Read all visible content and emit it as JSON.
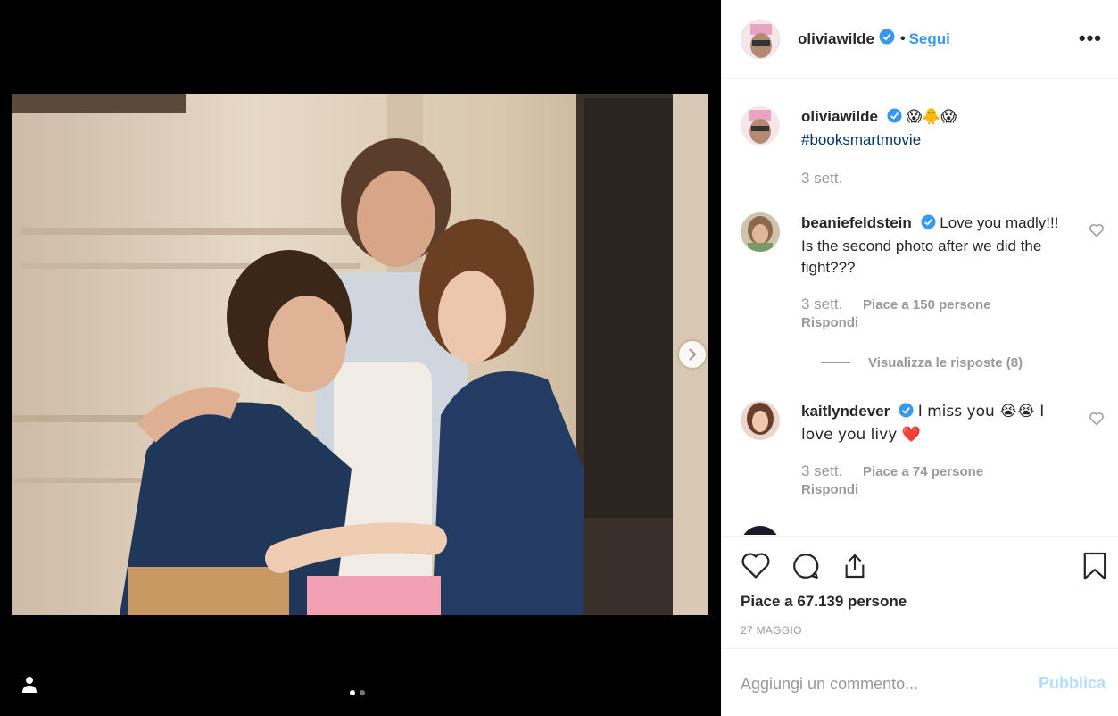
{
  "post": {
    "username": "oliviawilde",
    "separator": "•",
    "follow_label": "Segui",
    "more_label": "•••"
  },
  "caption": {
    "username": "oliviawilde",
    "emoji": "😱🐥😱",
    "hashtag": "#booksmartmovie",
    "time": "3 sett."
  },
  "comments": [
    {
      "username": "beaniefeldstein",
      "text": "Love you madly!!! Is the second photo after we did the fight???",
      "time": "3 sett.",
      "likes": "Piace a 150 persone",
      "reply_label": "Rispondi",
      "view_replies": "Visualizza le risposte (8)"
    },
    {
      "username": "kaitlyndever",
      "text": "I miss you 😭😭 I love you livy ❤️",
      "time": "3 sett.",
      "likes": "Piace a 74 persone",
      "reply_label": "Rispondi"
    }
  ],
  "likes_summary": "Piace a 67.139 persone",
  "date": "27 MAGGIO",
  "add_comment": {
    "placeholder": "Aggiungi un commento...",
    "publish_label": "Pubblica"
  },
  "carousel": {
    "total": 2,
    "current": 1
  },
  "colors": {
    "link_blue": "#3897f0",
    "verified_blue": "#3897f0",
    "hashtag": "#003569",
    "muted": "#999999",
    "publish_disabled": "#b3dbff"
  }
}
